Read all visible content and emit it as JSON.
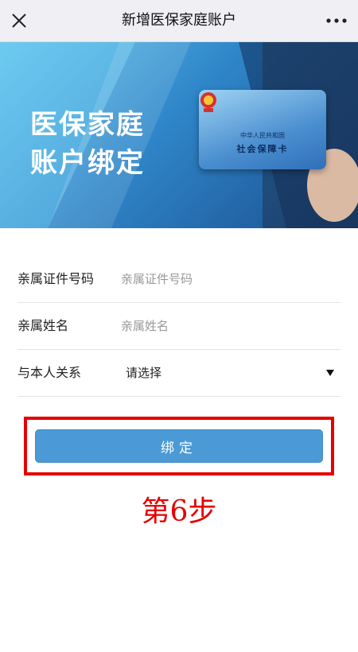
{
  "topbar": {
    "title": "新增医保家庭账户",
    "close_icon": "close-icon",
    "more_icon": "more-dots-icon"
  },
  "banner": {
    "headline_line1": "医保家庭",
    "headline_line2": "账户绑定",
    "card_line1": "中华人民共和国",
    "card_line2": "社会保障卡"
  },
  "form": {
    "id_number": {
      "label": "亲属证件号码",
      "placeholder": "亲属证件号码",
      "value": ""
    },
    "name": {
      "label": "亲属姓名",
      "placeholder": "亲属姓名",
      "value": ""
    },
    "relation": {
      "label": "与本人关系",
      "selected": "请选择"
    }
  },
  "actions": {
    "bind_label": "绑定"
  },
  "annotation": {
    "step_text": "第6步"
  },
  "colors": {
    "button": "#4b9ad6",
    "highlight": "#e60000",
    "topbar": "#efeff4"
  }
}
